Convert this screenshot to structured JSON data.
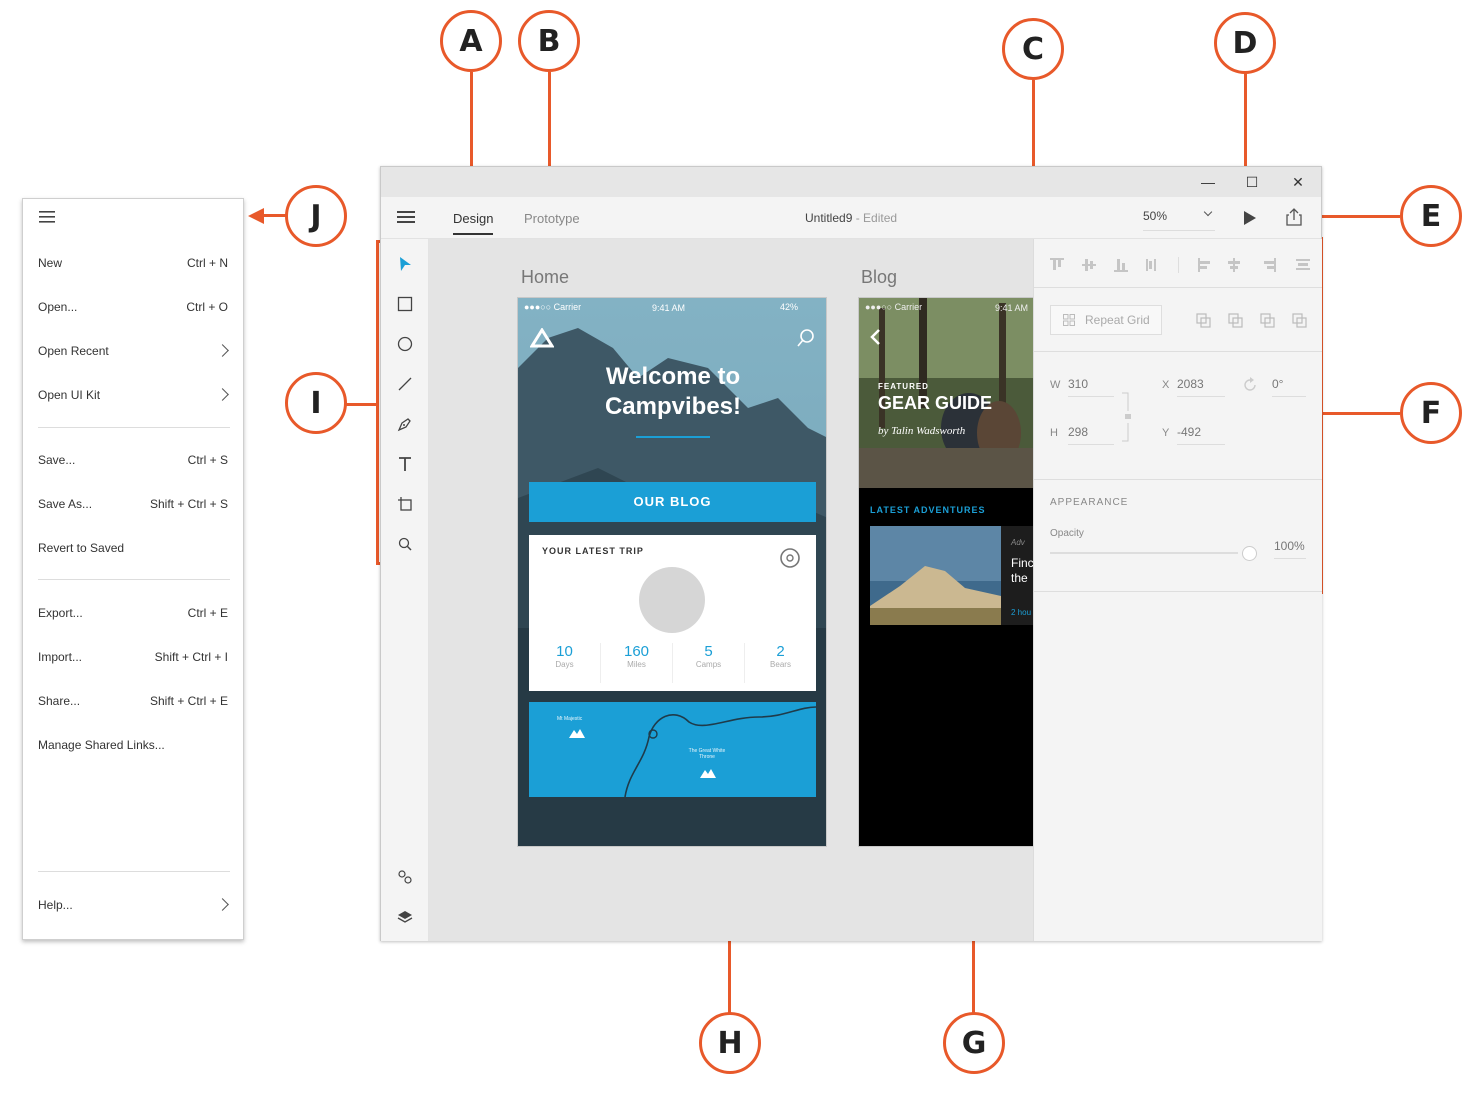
{
  "callouts": {
    "a": "A",
    "b": "B",
    "c": "C",
    "d": "D",
    "e": "E",
    "f": "F",
    "g": "G",
    "h": "H",
    "i": "I",
    "j": "J"
  },
  "colors": {
    "accent": "#e8592a",
    "blue": "#1b9fd6"
  },
  "window": {
    "controls": {
      "minimize": "—",
      "maximize": "☐",
      "close": "✕"
    },
    "tabs": [
      {
        "label": "Design",
        "active": true
      },
      {
        "label": "Prototype",
        "active": false
      }
    ],
    "doc_title": "Untitled9",
    "doc_status": " - Edited",
    "zoom": "50%"
  },
  "tools": [
    "select-tool",
    "rectangle-tool",
    "ellipse-tool",
    "line-tool",
    "pen-tool",
    "text-tool",
    "artboard-tool",
    "zoom-tool"
  ],
  "bottom_tools": [
    "symbols-icon",
    "layers-icon"
  ],
  "canvas": {
    "home": {
      "title": "Home",
      "status_carrier": "●●●○○ Carrier",
      "status_time": "9:41 AM",
      "status_battery": "42%",
      "headline1": "Welcome to",
      "headline2": "Campvibes!",
      "blog_button": "OUR BLOG",
      "trip_title": "YOUR LATEST TRIP",
      "stats": [
        {
          "value": "10",
          "label": "Days"
        },
        {
          "value": "160",
          "label": "Miles"
        },
        {
          "value": "5",
          "label": "Camps"
        },
        {
          "value": "2",
          "label": "Bears"
        }
      ],
      "map_label1": "Mt Majestic",
      "map_label2": "The Great White Throne"
    },
    "blog": {
      "title": "Blog",
      "status_carrier": "●●●○○ Carrier",
      "status_time": "9:41 AM",
      "featured": "FEATURED",
      "headline": "GEAR GUIDE",
      "byline": "by Talin Wadsworth",
      "latest": "LATEST ADVENTURES",
      "card_kicker": "Adv",
      "card_line1": "Finc",
      "card_line2": "the",
      "card_time": "2 hou"
    }
  },
  "properties": {
    "repeat_grid": "Repeat Grid",
    "w_label": "W",
    "w": "310",
    "x_label": "X",
    "x": "2083",
    "rot": "0°",
    "h_label": "H",
    "h": "298",
    "y_label": "Y",
    "y": "-492",
    "appearance": "APPEARANCE",
    "opacity_label": "Opacity",
    "opacity": "100%"
  },
  "menu": {
    "items": [
      {
        "label": "New",
        "shortcut": "Ctrl + N"
      },
      {
        "label": "Open...",
        "shortcut": "Ctrl + O"
      },
      {
        "label": "Open Recent",
        "shortcut": ""
      },
      {
        "label": "Open UI Kit",
        "shortcut": ""
      },
      {
        "label": "Save...",
        "shortcut": "Ctrl + S"
      },
      {
        "label": "Save As...",
        "shortcut": "Shift + Ctrl + S"
      },
      {
        "label": "Revert to Saved",
        "shortcut": ""
      },
      {
        "label": "Export...",
        "shortcut": "Ctrl + E"
      },
      {
        "label": "Import...",
        "shortcut": "Shift + Ctrl + I"
      },
      {
        "label": "Share...",
        "shortcut": "Shift + Ctrl + E"
      },
      {
        "label": "Manage Shared Links...",
        "shortcut": ""
      },
      {
        "label": "Help...",
        "shortcut": ""
      }
    ]
  }
}
